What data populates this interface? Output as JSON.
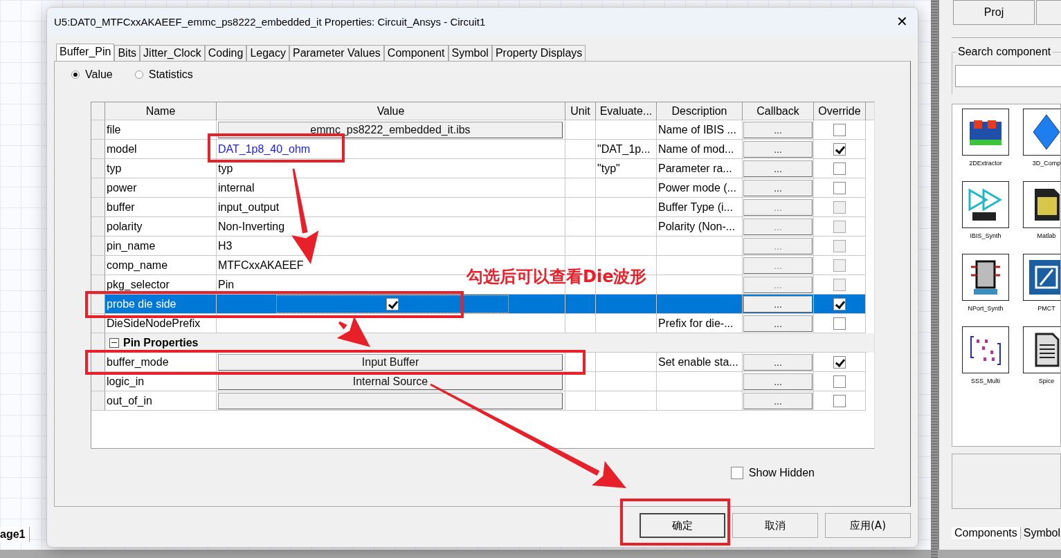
{
  "canvas": {
    "page_tab": "age1"
  },
  "window": {
    "title": "U5:DAT0_MTFCxxAKAEEF_emmc_ps8222_embedded_it Properties: Circuit_Ansys - Circuit1",
    "close": "✕"
  },
  "tabs": [
    {
      "label": "Buffer_Pin",
      "selected": true
    },
    {
      "label": "Bits",
      "selected": false
    },
    {
      "label": "Jitter_Clock",
      "selected": false
    },
    {
      "label": "Coding",
      "selected": false
    },
    {
      "label": "Legacy",
      "selected": false
    },
    {
      "label": "Parameter Values",
      "selected": false
    },
    {
      "label": "Component",
      "selected": false
    },
    {
      "label": "Symbol",
      "selected": false
    },
    {
      "label": "Property Displays",
      "selected": false
    }
  ],
  "view_options": [
    {
      "label": "Value",
      "selected": true
    },
    {
      "label": "Statistics",
      "selected": false
    }
  ],
  "table": {
    "columns": [
      "Name",
      "Value",
      "Unit",
      "Evaluate...",
      "Description",
      "Callback",
      "Override"
    ],
    "rows": [
      {
        "kind": "property",
        "name": "file",
        "value": {
          "kind": "button",
          "text": "emmc_ps8222_embedded_it.ibs"
        },
        "description": "Name of IBIS ...",
        "callback": "...",
        "override": false,
        "disabled": false,
        "selected": false
      },
      {
        "kind": "property",
        "name": "model",
        "value": {
          "kind": "link",
          "text": "DAT_1p8_40_ohm"
        },
        "evaluated": "\"DAT_1p...",
        "description": "Name of mod...",
        "callback": "...",
        "override": true,
        "disabled": false,
        "selected": false
      },
      {
        "kind": "property",
        "name": "typ",
        "value": {
          "kind": "text",
          "text": "typ"
        },
        "evaluated": "\"typ\"",
        "description": "Parameter ra...",
        "callback": "...",
        "override": false,
        "disabled": false,
        "selected": false
      },
      {
        "kind": "property",
        "name": "power",
        "value": {
          "kind": "text",
          "text": "internal"
        },
        "description": "Power mode (...",
        "callback": "...",
        "override": false,
        "disabled": false,
        "selected": false
      },
      {
        "kind": "property",
        "name": "buffer",
        "value": {
          "kind": "text",
          "text": "input_output"
        },
        "description": "Buffer Type (i...",
        "callback": "...",
        "override": false,
        "disabled": true,
        "selected": false
      },
      {
        "kind": "property",
        "name": "polarity",
        "value": {
          "kind": "text",
          "text": "Non-Inverting"
        },
        "description": "Polarity (Non-...",
        "callback": "...",
        "override": false,
        "disabled": true,
        "selected": false
      },
      {
        "kind": "property",
        "name": "pin_name",
        "value": {
          "kind": "text",
          "text": "H3"
        },
        "callback": "...",
        "override": false,
        "disabled": true,
        "selected": false
      },
      {
        "kind": "property",
        "name": "comp_name",
        "value": {
          "kind": "text",
          "text": "MTFCxxAKAEEF"
        },
        "callback": "...",
        "override": false,
        "disabled": true,
        "selected": false
      },
      {
        "kind": "property",
        "name": "pkg_selector",
        "value": {
          "kind": "text",
          "text": "Pin"
        },
        "callback": "...",
        "override": false,
        "disabled": true,
        "selected": false
      },
      {
        "kind": "property",
        "name": "probe die side",
        "value": {
          "kind": "checkbox",
          "checked": true
        },
        "callback": "...",
        "override": true,
        "disabled": false,
        "selected": true
      },
      {
        "kind": "property",
        "name": "DieSideNodePrefix",
        "description": "Prefix for die-...",
        "callback": "...",
        "override": false,
        "disabled": false,
        "selected": false
      },
      {
        "kind": "group",
        "label": "Pin Properties",
        "expanded": true
      },
      {
        "kind": "property",
        "name": "buffer_mode",
        "value": {
          "kind": "button",
          "text": "Input Buffer"
        },
        "description": "Set enable sta...",
        "callback": "...",
        "override": true,
        "disabled": false,
        "selected": false
      },
      {
        "kind": "property",
        "name": "logic_in",
        "value": {
          "kind": "button",
          "text": "Internal Source"
        },
        "callback": "...",
        "override": false,
        "disabled": false,
        "selected": false
      },
      {
        "kind": "property",
        "name": "out_of_in",
        "value": {
          "kind": "button"
        },
        "callback": "...",
        "override": false,
        "disabled": false,
        "selected": false
      }
    ]
  },
  "show_hidden": {
    "label": "Show Hidden",
    "checked": false
  },
  "buttons": [
    {
      "label": "确定",
      "default": true
    },
    {
      "label": "取消",
      "default": false
    },
    {
      "label": "应用(A)",
      "default": false
    }
  ],
  "annotation": {
    "note": "勾选后可以查看Die波形"
  },
  "side_panel": {
    "buttons": [
      "Proj"
    ],
    "search": {
      "label": "Search component"
    },
    "components": [
      {
        "label": "2DExtractor",
        "kind": "extractor"
      },
      {
        "label": "3D_Comp",
        "kind": "diamond"
      },
      {
        "label": "IBIS_Synth",
        "kind": "synth"
      },
      {
        "label": "Matlab",
        "kind": "matlab"
      },
      {
        "label": "NPort_Synth",
        "kind": "nport"
      },
      {
        "label": "PMCT",
        "kind": "pmct"
      },
      {
        "label": "SSS_Multi",
        "kind": "multi"
      },
      {
        "label": "Spice",
        "kind": "document"
      }
    ],
    "tabs": [
      {
        "label": "Components",
        "selected": true
      },
      {
        "label": "Symbol",
        "selected": false
      }
    ]
  }
}
